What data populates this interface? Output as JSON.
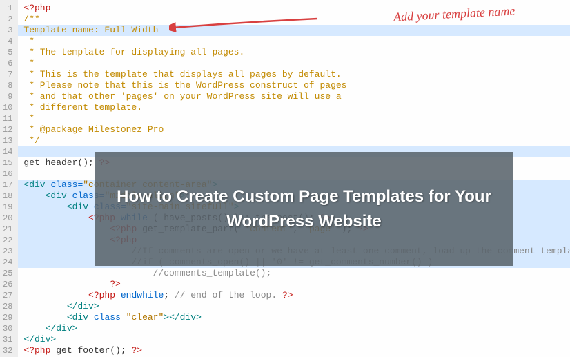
{
  "annotation": "Add your template name",
  "overlay_title": "How to Create Custom Page Templates for Your WordPress Website",
  "lines": [
    {
      "n": 1,
      "html": "<span class='k-php'>&lt;?php</span>"
    },
    {
      "n": 2,
      "html": "<span class='k-com'>/**</span>"
    },
    {
      "n": 3,
      "html": "<span class='k-com'>Template name: Full Width</span>",
      "hl": true
    },
    {
      "n": 4,
      "html": "<span class='k-com'> *</span>"
    },
    {
      "n": 5,
      "html": "<span class='k-com'> * The template for displaying all pages.</span>"
    },
    {
      "n": 6,
      "html": "<span class='k-com'> *</span>"
    },
    {
      "n": 7,
      "html": "<span class='k-com'> * This is the template that displays all pages by default.</span>"
    },
    {
      "n": 8,
      "html": "<span class='k-com'> * Please note that this is the WordPress construct of pages</span>"
    },
    {
      "n": 9,
      "html": "<span class='k-com'> * and that other 'pages' on your WordPress site will use a</span>"
    },
    {
      "n": 10,
      "html": "<span class='k-com'> * different template.</span>"
    },
    {
      "n": 11,
      "html": "<span class='k-com'> *</span>"
    },
    {
      "n": 12,
      "html": "<span class='k-com'> * @package Milestonez Pro</span>"
    },
    {
      "n": 13,
      "html": "<span class='k-com'> */</span>"
    },
    {
      "n": 14,
      "html": "",
      "hl": true
    },
    {
      "n": 15,
      "html": "<span class='k-func'>get_header();</span> <span class='k-php'>?&gt;</span>"
    },
    {
      "n": 16,
      "html": ""
    },
    {
      "n": 17,
      "html": "<span class='k-tag'>&lt;div</span> <span class='k-key'>class=</span><span class='k-str'>\"container content-area\"</span><span class='k-tag'>&gt;</span>",
      "hl": true
    },
    {
      "n": 18,
      "html": "    <span class='k-tag'>&lt;div</span> <span class='k-key'>class=</span><span class='k-str'>\"middle-align\"</span><span class='k-tag'>&gt;</span>",
      "hl": true
    },
    {
      "n": 19,
      "html": "        <span class='k-tag'>&lt;div</span> <span class='k-key'>class=</span><span class='k-str'>\"site-main sitefull\"</span><span class='k-tag'>&gt;</span>",
      "hl": true
    },
    {
      "n": 20,
      "html": "            <span class='k-php'>&lt;?php</span> <span class='k-key'>while</span> <span class='k-text'>( have_posts() ) : the_post();</span> <span class='k-php'>?&gt;</span>",
      "hl": true
    },
    {
      "n": 21,
      "html": "                <span class='k-php'>&lt;?php</span> <span class='k-text'>get_template_part(</span> <span class='k-str'>'content'</span><span class='k-text'>,</span> <span class='k-str'>'page'</span> <span class='k-text'>);</span> <span class='k-php'>?&gt;</span>",
      "hl": true
    },
    {
      "n": 22,
      "html": "                <span class='k-php'>&lt;?php</span>",
      "hl": true
    },
    {
      "n": 23,
      "html": "                    <span class='k-comg'>//If comments are open or we have at least one comment, load up the comment template</span>",
      "hl": true
    },
    {
      "n": 24,
      "html": "                    <span class='k-comg'>//if ( comments_open() || '0' != get_comments_number() )</span>",
      "hl": true
    },
    {
      "n": 25,
      "html": "                        <span class='k-comg'>//comments_template();</span>"
    },
    {
      "n": 26,
      "html": "                <span class='k-php'>?&gt;</span>"
    },
    {
      "n": 27,
      "html": "            <span class='k-php'>&lt;?php</span> <span class='k-key'>endwhile</span><span class='k-text'>;</span> <span class='k-comg'>// end of the loop.</span> <span class='k-php'>?&gt;</span>"
    },
    {
      "n": 28,
      "html": "        <span class='k-tag'>&lt;/div&gt;</span>"
    },
    {
      "n": 29,
      "html": "        <span class='k-tag'>&lt;div</span> <span class='k-key'>class=</span><span class='k-str'>\"clear\"</span><span class='k-tag'>&gt;&lt;/div&gt;</span>"
    },
    {
      "n": 30,
      "html": "    <span class='k-tag'>&lt;/div&gt;</span>"
    },
    {
      "n": 31,
      "html": "<span class='k-tag'>&lt;/div&gt;</span>"
    },
    {
      "n": 32,
      "html": "<span class='k-php'>&lt;?php</span> <span class='k-text'>get_footer();</span> <span class='k-php'>?&gt;</span>"
    }
  ]
}
